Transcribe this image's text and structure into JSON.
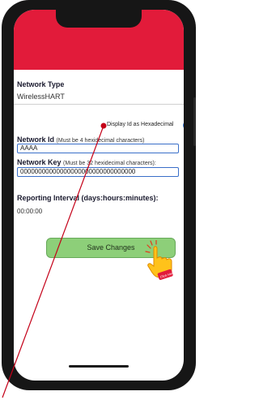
{
  "network_type": {
    "label": "Network Type",
    "value": "WirelessHART"
  },
  "display_hex": {
    "label": "Display Id as Hexadecimal",
    "checked": true
  },
  "network_id": {
    "label": "Network Id",
    "hint": "(Must be 4 hexidecimal characters)",
    "value": "AAAA"
  },
  "network_key": {
    "label": "Network Key",
    "hint": "(Must be 32 hexidecimal characters):",
    "value": "00000000000000000000000000000000"
  },
  "reporting_interval": {
    "label": "Reporting Interval (days:hours:minutes):",
    "value": "00:00:00"
  },
  "save_button": {
    "label": "Save Changes"
  },
  "click_badge": {
    "label": "Click Here"
  },
  "colors": {
    "header": "#e21b3a",
    "save_button": "#8dcf79",
    "input_border": "#3a6fc9",
    "checkbox": "#2f6fd6",
    "pointer_line": "#c40018"
  }
}
